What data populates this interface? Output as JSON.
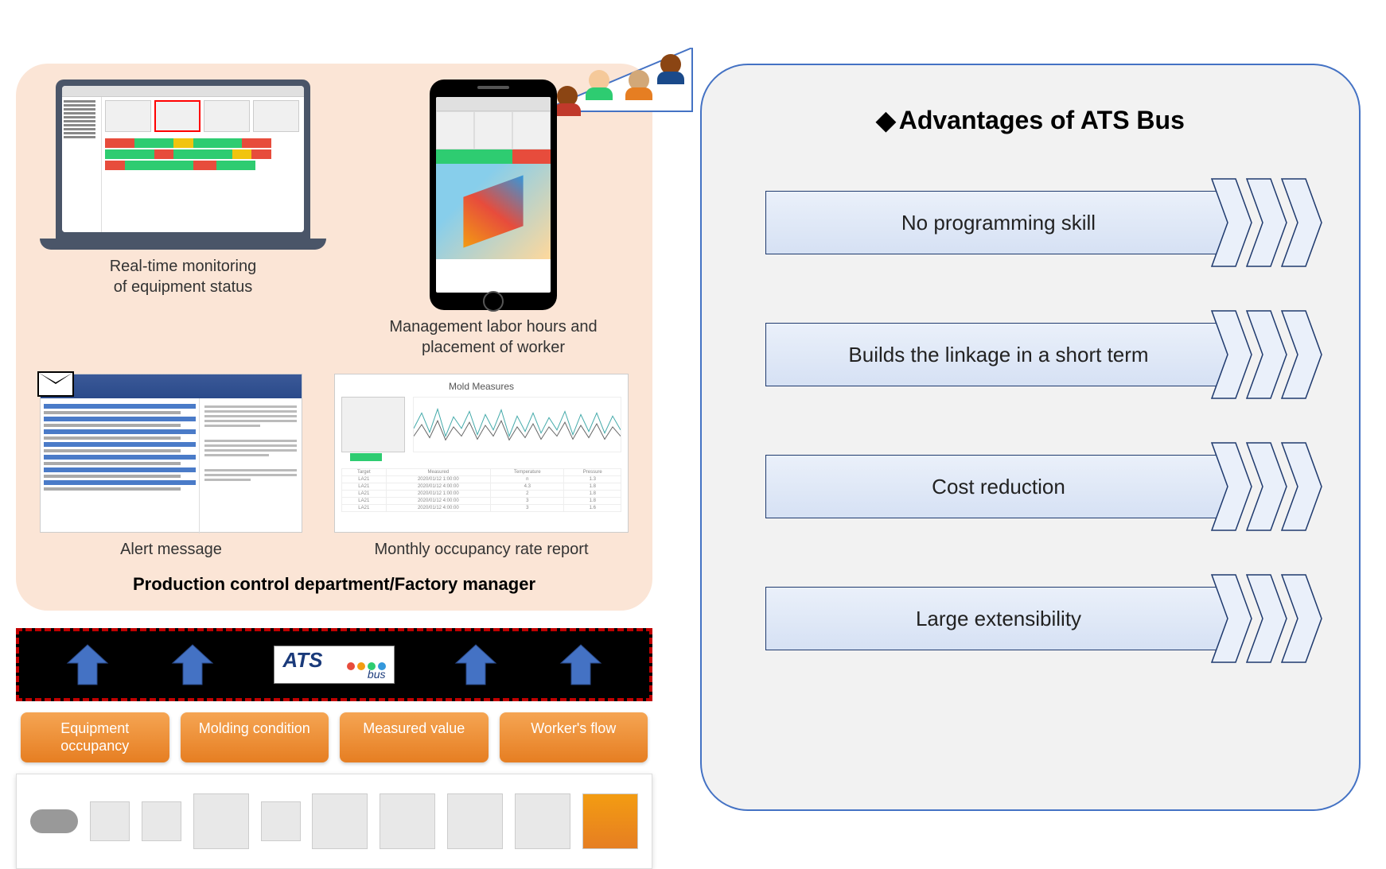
{
  "left": {
    "cards": {
      "monitoring": "Real-time monitoring\nof equipment status",
      "labor": "Management labor hours and\nplacement of worker",
      "alert": "Alert message",
      "report": "Monthly occupancy rate report"
    },
    "report_title": "Mold Measures",
    "dept_title": "Production control department/Factory manager",
    "ats_main": "ATS",
    "ats_sub": "bus",
    "pills": [
      "Equipment occupancy",
      "Molding condition",
      "Measured value",
      "Worker's flow"
    ]
  },
  "right": {
    "title": "Advantages of ATS Bus",
    "items": [
      "No programming skill",
      "Builds the linkage in a short term",
      "Cost reduction",
      "Large extensibility"
    ]
  },
  "colors": {
    "peach": "#fbe5d6",
    "blue_border": "#4472c4",
    "red_dash": "#c00000",
    "orange": "#e67e22",
    "grey_panel": "#f2f2f2"
  }
}
